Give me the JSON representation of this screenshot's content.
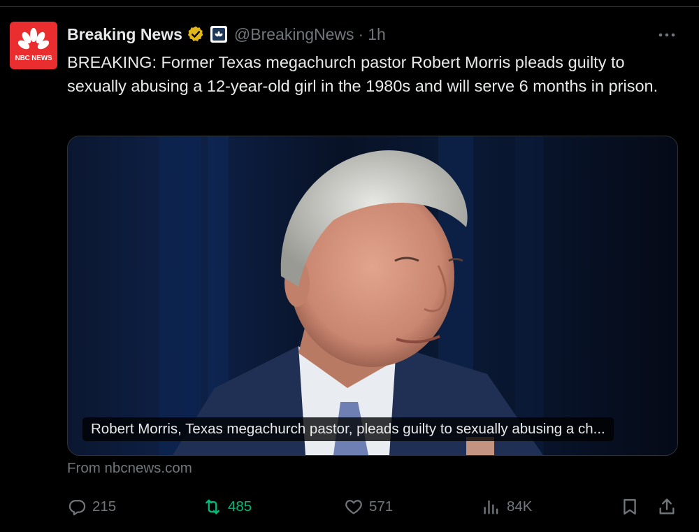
{
  "tweet": {
    "author": {
      "display_name": "Breaking News",
      "handle": "@BreakingNews",
      "separator": "·",
      "time": "1h",
      "avatar_text": "NBC NEWS",
      "avatar_color": "#ea2e2f",
      "verified_color": "#e2b719"
    },
    "text": "BREAKING: Former Texas megachurch pastor Robert Morris pleads guilty to sexually abusing a 12-year-old girl in the 1980s and will serve 6 months in prison.",
    "card": {
      "caption": "Robert Morris, Texas megachurch pastor, pleads guilty to sexually abusing a ch...",
      "source": "From nbcnews.com"
    },
    "actions": {
      "replies": "215",
      "reposts": "485",
      "likes": "571",
      "views": "84K"
    },
    "icons": {
      "reply": "reply-icon",
      "repost": "repost-icon",
      "like": "heart-icon",
      "views": "views-icon",
      "bookmark": "bookmark-icon",
      "share": "share-icon",
      "more": "more-icon"
    },
    "colors": {
      "background": "#000000",
      "text": "#e7e9ea",
      "muted": "#71767b",
      "repost_active": "#00ba7c"
    }
  }
}
